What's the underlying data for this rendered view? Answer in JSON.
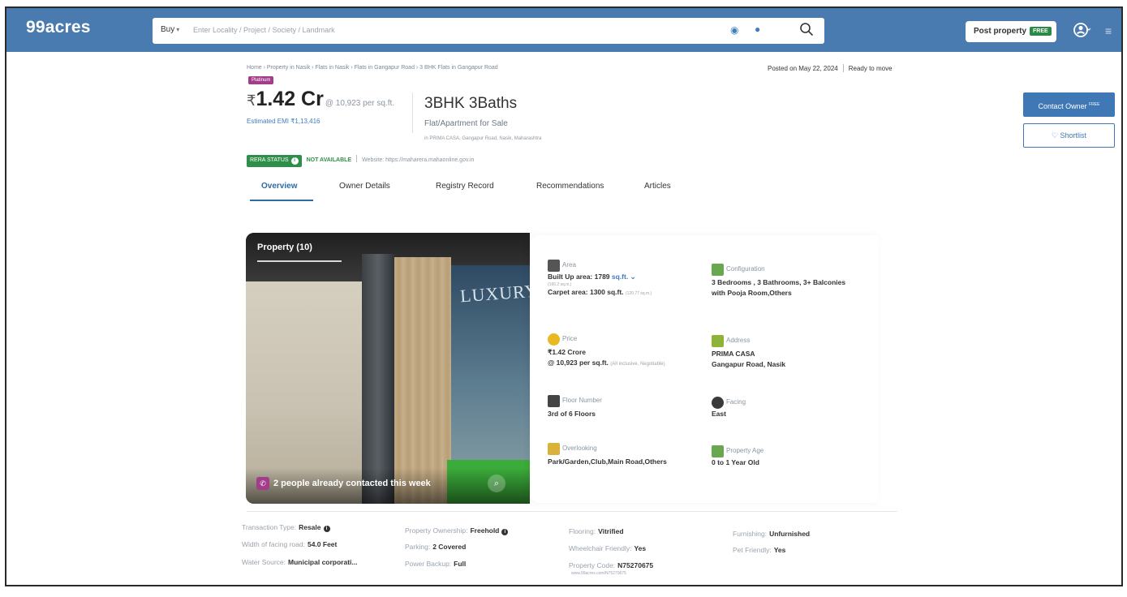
{
  "header": {
    "logo": "99acres",
    "buy_label": "Buy",
    "search_placeholder": "Enter Locality / Project / Society / Landmark",
    "post_property": "Post property",
    "free_tag": "FREE",
    "menu_glyph": "≡"
  },
  "breadcrumb": "Home › Property in Nasik › Flats in Nasik › Flats in Gangapur Road › 3 BHK Flats in Gangapur Road",
  "posted": "Posted on May 22, 2024",
  "status": "Ready to move",
  "badge": "Platinum",
  "price": {
    "currency": "₹",
    "value": "1.42 Cr",
    "per_sqft": "@ 10,923 per sq.ft.",
    "emi": "Estimated EMI ₹1,13,416"
  },
  "listing": {
    "title": "3BHK 3Baths",
    "subtitle": "Flat/Apartment for Sale",
    "location": "in PRIMA CASA, Gangapur Road, Nasik, Maharashtra"
  },
  "rera": {
    "badge": "RERA STATUS",
    "status": "NOT AVAILABLE",
    "website": "Website: https://maharera.mahaonline.gov.in"
  },
  "tabs": [
    {
      "label": "Overview"
    },
    {
      "label": "Owner Details"
    },
    {
      "label": "Registry Record"
    },
    {
      "label": "Recommendations"
    },
    {
      "label": "Articles"
    }
  ],
  "gallery": {
    "title": "Property (10)",
    "screen_text": "LUXURY",
    "contact_note": "2 people already contacted this week"
  },
  "details": {
    "area": {
      "label": "Area",
      "built_up": "Built Up area: 1789",
      "unit": "sq.ft.",
      "built_up_sqm": "(166.2 sq.m.)",
      "carpet": "Carpet area: 1300 sq.ft.",
      "carpet_sqm": "(120.77 sq.m.)"
    },
    "configuration": {
      "label": "Configuration",
      "line1": "3 Bedrooms , 3 Bathrooms, 3+ Balconies",
      "line2": "with Pooja Room,Others"
    },
    "price": {
      "label": "Price",
      "line1": "₹1.42 Crore",
      "line2": "@ 10,923 per sq.ft.",
      "note": "(All inclusive, Negotiable)"
    },
    "address": {
      "label": "Address",
      "line1": "PRIMA CASA",
      "line2": "Gangapur Road, Nasik"
    },
    "floor": {
      "label": "Floor Number",
      "value": "3rd  of 6 Floors"
    },
    "facing": {
      "label": "Facing",
      "value": "East"
    },
    "overlooking": {
      "label": "Overlooking",
      "value": "Park/Garden,Club,Main Road,Others"
    },
    "age": {
      "label": "Property Age",
      "value": "0 to 1 Year Old"
    }
  },
  "cta": {
    "contact": "Contact Owner",
    "contact_tag": "FREE",
    "shortlist": "Shortlist"
  },
  "facts": {
    "transaction_type": {
      "k": "Transaction Type:",
      "v": "Resale"
    },
    "road_width": {
      "k": "Width of facing road:",
      "v": "54.0 Feet"
    },
    "water": {
      "k": "Water Source:",
      "v": "Municipal corporati..."
    },
    "ownership": {
      "k": "Property Ownership:",
      "v": "Freehold"
    },
    "parking": {
      "k": "Parking:",
      "v": "2 Covered"
    },
    "power": {
      "k": "Power Backup:",
      "v": "Full"
    },
    "flooring": {
      "k": "Flooring:",
      "v": "Vitrified"
    },
    "wheelchair": {
      "k": "Wheelchair Friendly:",
      "v": "Yes"
    },
    "code": {
      "k": "Property Code:",
      "v": "N75270675"
    },
    "code_url": "www.99acres.com/N75270675",
    "furnishing": {
      "k": "Furnishing:",
      "v": "Unfurnished"
    },
    "pet": {
      "k": "Pet Friendly:",
      "v": "Yes"
    }
  },
  "colors": {
    "header_bg": "#4a7bb0",
    "accent": "#3f78b5",
    "rera_green": "#2f8f4a",
    "platinum": "#a23d8c"
  }
}
